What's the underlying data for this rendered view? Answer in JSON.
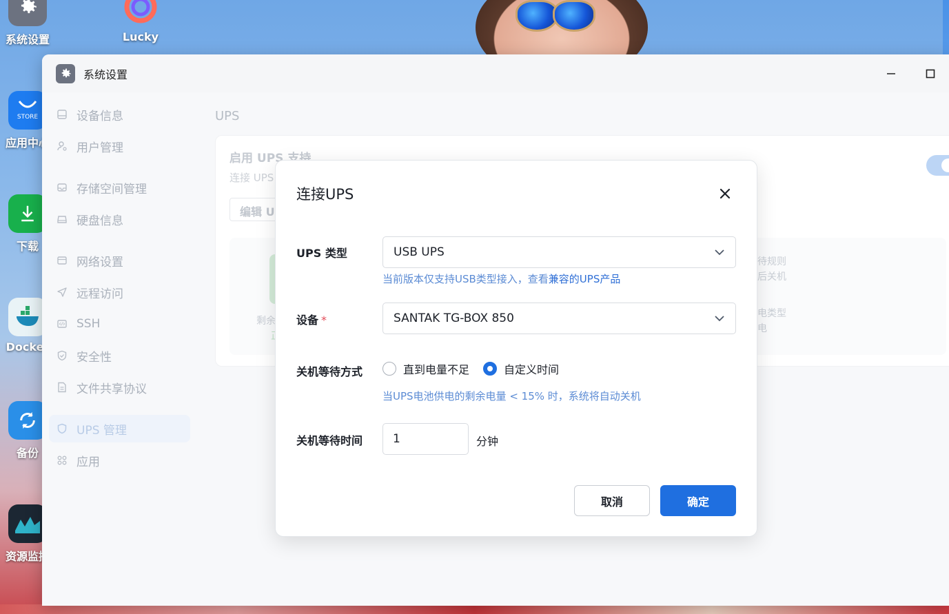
{
  "desktop": {
    "icons": [
      {
        "label": "系统设置",
        "icon": "gear-icon",
        "color": "#6c7280"
      },
      {
        "label": "Lucky",
        "icon": "lucky-icon",
        "color": "#ff6b5a"
      },
      {
        "label": "应用中心",
        "icon": "store-icon",
        "color": "#1e7cf0",
        "badge": "STORE"
      },
      {
        "label": "下载",
        "icon": "download-icon",
        "color": "#18b04c"
      },
      {
        "label": "Docker",
        "icon": "docker-icon",
        "color": "#e9f3f6"
      },
      {
        "label": "备份",
        "icon": "backup-icon",
        "color": "#2a8fe8"
      },
      {
        "label": "资源监控",
        "icon": "monitor-icon",
        "color": "#1c2733"
      }
    ]
  },
  "window": {
    "title": "系统设置",
    "app_icon": "gear-icon"
  },
  "sidebar": {
    "items": [
      {
        "label": "设备信息",
        "icon": "device-icon"
      },
      {
        "label": "用户管理",
        "icon": "user-icon"
      },
      {
        "label": "存储空间管理",
        "icon": "storage-icon"
      },
      {
        "label": "硬盘信息",
        "icon": "disk-icon"
      },
      {
        "label": "网络设置",
        "icon": "network-icon"
      },
      {
        "label": "远程访问",
        "icon": "remote-icon"
      },
      {
        "label": "SSH",
        "icon": "ssh-icon"
      },
      {
        "label": "安全性",
        "icon": "shield-check-icon"
      },
      {
        "label": "文件共享协议",
        "icon": "file-share-icon"
      },
      {
        "label": "UPS 管理",
        "icon": "ups-shield-icon",
        "active": true
      },
      {
        "label": "应用",
        "icon": "apps-icon"
      }
    ]
  },
  "main": {
    "title": "UPS",
    "card": {
      "heading": "启用 UPS 支持",
      "subtitle": "连接 UPS",
      "edit_button": "编辑 U",
      "remaining_label": "剩余",
      "status_frag": "正",
      "rule_frag_1": "待规则",
      "rule_frag_2": "后关机",
      "power_frag_1": "电类型",
      "power_frag_2": "电"
    }
  },
  "modal": {
    "title": "连接UPS",
    "ups_type_label": "UPS 类型",
    "ups_type_value": "USB UPS",
    "ups_type_hint_prefix": "当前版本仅支持USB类型接入，查看",
    "ups_type_hint_link": "兼容的UPS产品",
    "device_label": "设备",
    "device_required": "*",
    "device_value": "SANTAK TG-BOX 850",
    "wait_mode_label": "关机等待方式",
    "wait_mode_options": [
      "直到电量不足",
      "自定义时间"
    ],
    "wait_mode_selected": "自定义时间",
    "wait_mode_hint": "当UPS电池供电的剩余电量 < 15% 时，系统将自动关机",
    "wait_time_label": "关机等待时间",
    "wait_time_value": "1",
    "wait_time_unit": "分钟",
    "cancel_label": "取消",
    "ok_label": "确定"
  },
  "colors": {
    "primary": "#1f6fe0",
    "link": "#2f6fd6",
    "required": "#e34d59"
  }
}
